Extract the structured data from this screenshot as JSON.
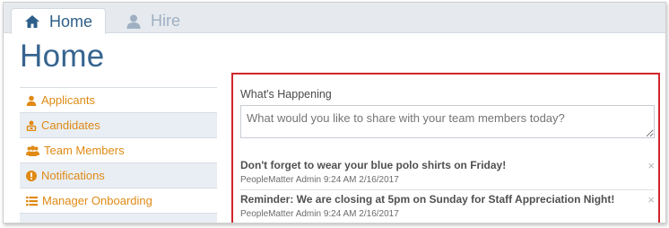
{
  "tabs": [
    {
      "label": "Home",
      "icon": "home-icon",
      "active": true
    },
    {
      "label": "Hire",
      "icon": "user-icon",
      "active": false
    }
  ],
  "page_title": "Home",
  "sidebar": {
    "items": [
      {
        "label": "Applicants",
        "icon": "user-icon"
      },
      {
        "label": "Candidates",
        "icon": "candidate-icon"
      },
      {
        "label": "Team Members",
        "icon": "group-icon"
      },
      {
        "label": "Notifications",
        "icon": "exclamation-icon"
      },
      {
        "label": "Manager Onboarding",
        "icon": "list-icon"
      }
    ]
  },
  "feed": {
    "label": "What's Happening",
    "placeholder": "What would you like to share with your team members today?",
    "posts": [
      {
        "title": "Don't forget to wear your blue polo shirts on Friday!",
        "meta": "PeopleMatter Admin 9:24 AM 2/16/2017",
        "close": "×"
      },
      {
        "title": "Reminder: We are closing at 5pm on Sunday for Staff Appreciation Night!",
        "meta": "PeopleMatter Admin 9:24 AM 2/16/2017",
        "close": "×"
      }
    ]
  },
  "colors": {
    "accent_orange": "#e08a14",
    "title_blue": "#36648f",
    "highlight_red": "#d0262c"
  }
}
